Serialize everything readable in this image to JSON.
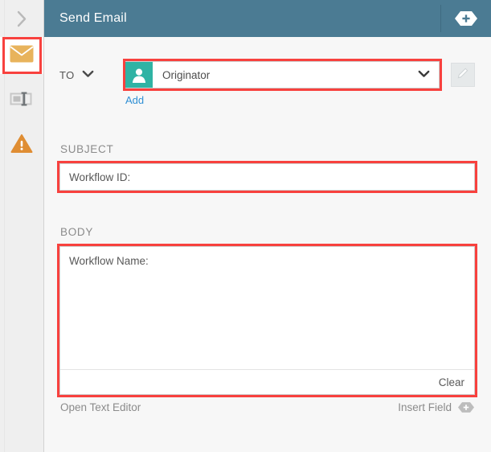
{
  "window": {
    "title": "Send Email"
  },
  "colors": {
    "header_bg": "#4b7b93",
    "highlight": "#f8413e",
    "avatar_bg": "#2fb3a4",
    "link": "#2f8fd4",
    "rail_bg": "#efefef",
    "envelope": "#e8b35c",
    "warning": "#df8d33"
  },
  "rail": {
    "expand_icon": "chevron-right-icon",
    "items": [
      {
        "icon": "envelope-icon",
        "name": "email-step",
        "active": true,
        "highlighted": true
      },
      {
        "icon": "text-field-icon",
        "name": "form-step",
        "active": false,
        "highlighted": false
      },
      {
        "icon": "warning-triangle-icon",
        "name": "alert-step",
        "active": false,
        "highlighted": false
      }
    ]
  },
  "header": {
    "title": "Send Email",
    "add_icon": "hexagon-plus-icon"
  },
  "form": {
    "to": {
      "label": "TO",
      "dropdown_icon": "chevron-down-icon",
      "recipient_icon": "person-icon",
      "recipient_value": "Originator",
      "recipient_chevron_icon": "chevron-down-icon",
      "add_label": "Add",
      "edit_icon": "pencil-icon",
      "edit_disabled": true,
      "highlighted": true
    },
    "subject": {
      "label": "SUBJECT",
      "value": "Workflow ID:",
      "placeholder": "Workflow ID:",
      "highlighted": true
    },
    "body": {
      "label": "BODY",
      "value": "Workflow Name:",
      "placeholder": "Workflow Name:",
      "clear_label": "Clear",
      "highlighted": true
    }
  },
  "footer": {
    "open_text_editor_label": "Open Text Editor",
    "insert_field_label": "Insert Field",
    "insert_field_icon": "hexagon-plus-icon"
  }
}
